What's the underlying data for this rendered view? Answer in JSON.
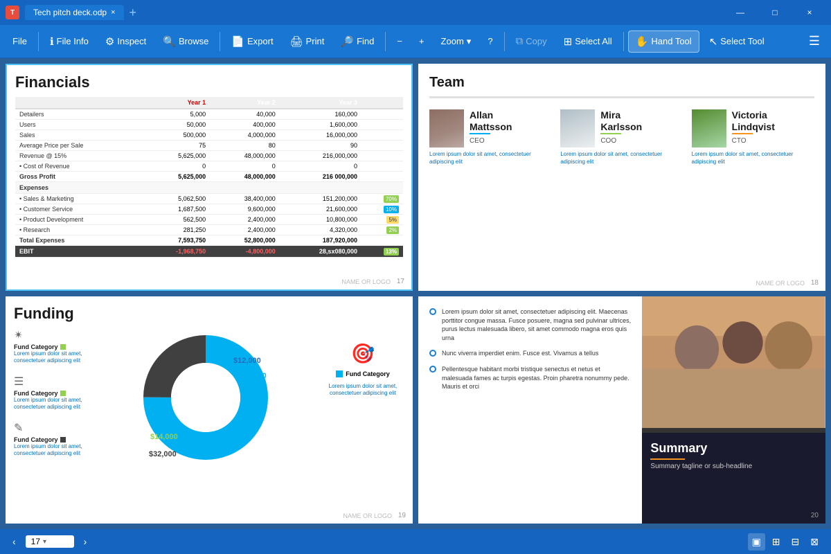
{
  "titlebar": {
    "filename": "Tech pitch deck.odp",
    "close_label": "×",
    "new_tab": "+",
    "minimize": "—",
    "maximize": "□",
    "close_win": "×"
  },
  "toolbar": {
    "file": "File",
    "file_info": "File Info",
    "inspect": "Inspect",
    "browse": "Browse",
    "export": "Export",
    "print": "Print",
    "find": "Find",
    "zoom_out": "−",
    "zoom_in": "+",
    "zoom": "Zoom",
    "copy": "Copy",
    "select_all": "Select All",
    "hand_tool": "Hand Tool",
    "select_tool": "Select Tool"
  },
  "slides": {
    "slide17": {
      "title": "Financials",
      "number": "17",
      "logo": "NAME OR LOGO",
      "table": {
        "headers": [
          "",
          "Year 1",
          "Year 2",
          "Year 3"
        ],
        "rows": [
          [
            "Detailers",
            "5,000",
            "40,000",
            "160,000"
          ],
          [
            "Users",
            "50,000",
            "400,000",
            "1,600,000"
          ],
          [
            "Sales",
            "500,000",
            "4,000,000",
            "16,000,000"
          ],
          [
            "Average Price per Sale",
            "75",
            "80",
            "90"
          ],
          [
            "Revenue @ 15%",
            "5,625,000",
            "48,000,000",
            "216,000,000"
          ],
          [
            "• Cost of Revenue",
            "0",
            "0",
            "0"
          ],
          [
            "Gross Profit",
            "5,625,000",
            "48,000,000",
            "216 000,000"
          ],
          [
            "Expenses",
            "",
            "",
            ""
          ],
          [
            "• Sales & Marketing",
            "5,062,500",
            "38,400,000",
            "151,200,000",
            "70%"
          ],
          [
            "• Customer Service",
            "1,687,500",
            "9,600,000",
            "21,600,000",
            "10%"
          ],
          [
            "• Product Development",
            "562,500",
            "2,400,000",
            "10,800,000",
            "5%"
          ],
          [
            "• Research",
            "281,250",
            "2,400,000",
            "4,320,000",
            "2%"
          ],
          [
            "Total Expenses",
            "7,593,750",
            "52,800,000",
            "187,920,000"
          ],
          [
            "EBIT",
            "-1,968,750",
            "-4,800,000",
            "28,sx080,000",
            "13%"
          ]
        ]
      }
    },
    "slide18": {
      "title": "Team",
      "number": "18",
      "logo": "NAME OR LOGO",
      "members": [
        {
          "name": "Allan Mattsson",
          "role": "CEO",
          "desc": "Lorem ipsum dolor sit amet, consectetuer adipiscing elit"
        },
        {
          "name": "Mira Karlsson",
          "role": "COO",
          "desc": "Lorem ipsum dolor sit amet, consectetuer adipiscing elit"
        },
        {
          "name": "Victoria Lindqvist",
          "role": "CTO",
          "desc": "Lorem ipsum dolor sit amet, consectetuer adipiscing elit"
        }
      ]
    },
    "slide19": {
      "title": "Funding",
      "number": "19",
      "logo": "NAME OR LOGO",
      "legend_items": [
        {
          "icon": "✴",
          "label": "Fund Category",
          "color": "#92d050",
          "desc": "Lorem ipsum dolor sit amet, consectetuer adipiscing elit"
        },
        {
          "icon": "☰",
          "label": "Fund Category",
          "color": "#92d050",
          "desc": "Lorem ipsum dolor sit amet, consectetuer adipiscing elit"
        },
        {
          "icon": "✎",
          "label": "Fund Category",
          "color": "#404040",
          "desc": "Lorem ipsum dolor sit amet, consectetuer adipiscing elit"
        }
      ],
      "donut": {
        "segments": [
          {
            "value": 82000,
            "label": "$82,000",
            "color": "#00b0f0",
            "angle": 190
          },
          {
            "value": 32000,
            "label": "$32,000",
            "color": "#404040",
            "angle": 85
          },
          {
            "value": 14000,
            "label": "$14,000",
            "color": "#92d050",
            "angle": 37
          },
          {
            "value": 12000,
            "label": "$12,000",
            "color": "#1f6fbf",
            "angle": 48
          }
        ]
      },
      "right_label": "Fund Category",
      "right_desc": "Lorem ipsum dolor sit amet, consectetuer adipiscing elit"
    },
    "slide20": {
      "number": "20",
      "bullets": [
        "Lorem ipsum dolor sit amet, consectetuer adipiscing elit. Maecenas porttitor congue massa. Fusce posuere, magna sed pulvinar ultrices, purus lectus malesuada libero, sit amet commodo magna eros quis urna",
        "Nunc viverra imperdiet enim. Fusce est. Vivamus a tellus",
        "Pellentesque habitant morbi tristique senectus et netus et malesuada fames ac turpis egestas. Proin pharetra nonummy pede. Mauris et orci"
      ],
      "summary_title": "Summary",
      "summary_tagline": "Summary tagline or sub-headline"
    }
  },
  "statusbar": {
    "page": "17",
    "nav_prev": "‹",
    "nav_next": "›"
  }
}
